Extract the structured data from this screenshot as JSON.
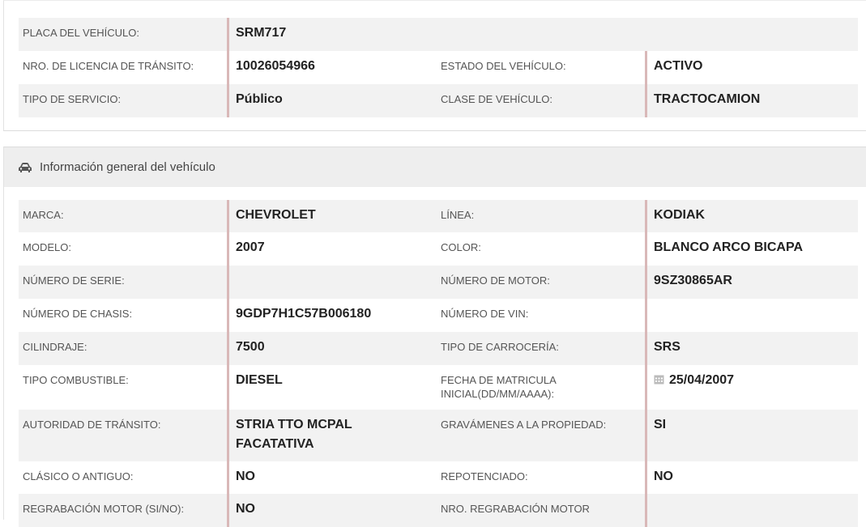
{
  "top_section": {
    "rows": [
      {
        "l1": "PLACA DEL VEHÍCULO:",
        "v1": "SRM717",
        "l2": "",
        "v2": ""
      },
      {
        "l1": "NRO. DE LICENCIA DE TRÁNSITO:",
        "v1": "10026054966",
        "l2": "ESTADO DEL VEHÍCULO:",
        "v2": "ACTIVO"
      },
      {
        "l1": "TIPO DE SERVICIO:",
        "v1": "Público",
        "l2": "CLASE DE VEHÍCULO:",
        "v2": "TRACTOCAMION"
      }
    ]
  },
  "general": {
    "header_icon": "car-icon",
    "title": "Información general del vehículo",
    "rows": [
      {
        "l1": "MARCA:",
        "v1": "CHEVROLET",
        "l2": "LÍNEA:",
        "v2": "KODIAK"
      },
      {
        "l1": "MODELO:",
        "v1": "2007",
        "l2": "COLOR:",
        "v2": "BLANCO ARCO BICAPA"
      },
      {
        "l1": "NÚMERO DE SERIE:",
        "v1": "",
        "l2": "NÚMERO DE MOTOR:",
        "v2": "9SZ30865AR"
      },
      {
        "l1": "NÚMERO DE CHASIS:",
        "v1": "9GDP7H1C57B006180",
        "l2": "NÚMERO DE VIN:",
        "v2": ""
      },
      {
        "l1": "CILINDRAJE:",
        "v1": "7500",
        "l2": "TIPO DE CARROCERÍA:",
        "v2": "SRS"
      },
      {
        "l1": "TIPO COMBUSTIBLE:",
        "v1": "DIESEL",
        "l2": "FECHA DE MATRICULA INICIAL(DD/MM/AAAA):",
        "v2": "25/04/2007",
        "v2_icon": "calendar-icon"
      },
      {
        "l1": "AUTORIDAD DE TRÁNSITO:",
        "v1": "STRIA TTO MCPAL FACATATIVA",
        "l2": "GRAVÁMENES A LA PROPIEDAD:",
        "v2": "SI"
      },
      {
        "l1": "CLÁSICO O ANTIGUO:",
        "v1": "NO",
        "l2": "REPOTENCIADO:",
        "v2": "NO"
      },
      {
        "l1": "REGRABACIÓN MOTOR (SI/NO):",
        "v1": "NO",
        "l2": "NRO. REGRABACIÓN MOTOR",
        "v2": ""
      }
    ]
  }
}
